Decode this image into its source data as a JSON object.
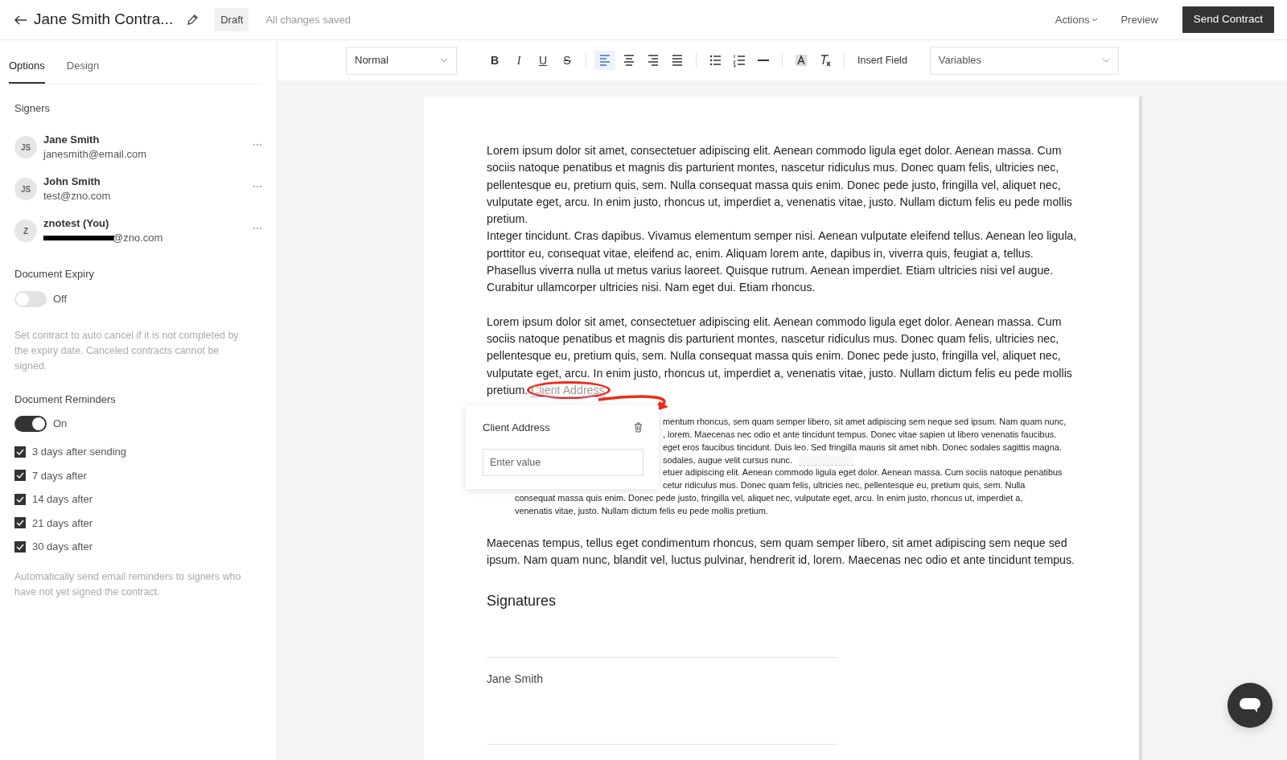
{
  "header": {
    "title": "Jane Smith Contra...",
    "status": "Draft",
    "save_state": "All changes saved",
    "actions": "Actions",
    "preview": "Preview",
    "primary": "Send Contract"
  },
  "sidebar": {
    "tabs": [
      {
        "label": "Options",
        "selected": true
      },
      {
        "label": "Design",
        "selected": false
      }
    ],
    "signers_heading": "Signers",
    "signers": [
      {
        "initials": "JS",
        "name": "Jane Smith",
        "email": "janesmith@email.com",
        "redacted": false
      },
      {
        "initials": "JS",
        "name": "John Smith",
        "email": "test@zno.com",
        "redacted": false
      },
      {
        "initials": "Z",
        "name": "znotest (You)",
        "email": "@zno.com",
        "redacted": true
      }
    ],
    "expiry": {
      "heading": "Document Expiry",
      "on": false,
      "state_label": "Off",
      "help": "Set contract to auto cancel if it is not completed by the expiry date. Canceled contracts cannot be signed."
    },
    "reminders": {
      "heading": "Document Reminders",
      "on": true,
      "state_label": "On",
      "items": [
        {
          "label": "3 days after sending",
          "checked": true
        },
        {
          "label": "7 days after",
          "checked": true
        },
        {
          "label": "14 days after",
          "checked": true
        },
        {
          "label": "21 days after",
          "checked": true
        },
        {
          "label": "30 days after",
          "checked": true
        }
      ],
      "help": "Automatically send email reminders to signers who have not yet signed the contract."
    }
  },
  "toolbar": {
    "style": "Normal",
    "tool_groups": [
      [
        {
          "kind": "bold",
          "label": "B",
          "selected": false
        },
        {
          "kind": "italic",
          "label": "I",
          "selected": false
        },
        {
          "kind": "underline",
          "label": "U",
          "selected": false
        },
        {
          "kind": "strike",
          "label": "S",
          "selected": false
        }
      ],
      [
        {
          "kind": "align-left",
          "selected": true
        },
        {
          "kind": "align-center",
          "selected": false
        },
        {
          "kind": "align-right",
          "selected": false
        },
        {
          "kind": "justify",
          "selected": false
        }
      ],
      [
        {
          "kind": "bullets",
          "selected": false
        },
        {
          "kind": "numbers",
          "selected": false
        },
        {
          "kind": "rule",
          "selected": false
        }
      ],
      [
        {
          "kind": "highlight",
          "selected": false
        },
        {
          "kind": "clear",
          "selected": false
        }
      ]
    ],
    "insert_field": "Insert Field",
    "variables": "Variables"
  },
  "document": {
    "blocks": [
      {
        "kind": "text",
        "paragraphs": [
          "Lorem ipsum dolor sit amet, consectetuer adipiscing elit. Aenean commodo ligula eget dolor. Aenean massa. Cum sociis natoque penatibus et magnis dis parturient montes, nascetur ridiculus mus. Donec quam felis, ultricies nec, pellentesque eu, pretium quis, sem. Nulla consequat massa quis enim. Donec pede justo, fringilla vel, aliquet nec, vulputate eget, arcu. In enim justo, rhoncus ut, imperdiet a, venenatis vitae, justo. Nullam dictum felis eu pede mollis pretium.",
          "Integer tincidunt. Cras dapibus. Vivamus elementum semper nisi. Aenean vulputate eleifend tellus. Aenean leo ligula, porttitor eu, consequat vitae, eleifend ac, enim. Aliquam lorem ante, dapibus in, viverra quis, feugiat a, tellus. Phasellus viverra nulla ut metus varius laoreet. Quisque rutrum. Aenean imperdiet. Etiam ultricies nisi vel augue. Curabitur ullamcorper ultricies nisi. Nam eget dui. Etiam rhoncus."
        ]
      },
      {
        "kind": "text",
        "paragraphs": [
          "Lorem ipsum dolor sit amet, consectetuer adipiscing elit. Aenean commodo ligula eget dolor. Aenean massa. Cum sociis natoque penatibus et magnis dis parturient montes, nascetur ridiculus mus. Donec quam felis, ultricies nec, pellentesque eu, pretium quis, sem. Nulla consequat massa quis enim. Donec pede justo, fringilla vel, aliquet nec, vulputate eget, arcu. In enim justo, rhoncus ut, imperdiet a, venenatis vitae, justo. Nullam dictum felis eu pede mollis pretium."
        ],
        "field": "Client Address"
      },
      {
        "kind": "quote",
        "popup": {
          "title": "Client Address",
          "placeholder": "Enter value"
        },
        "lines": [
          {
            "kind": "cut",
            "text": "mentum rhoncus, sem quam semper libero, sit amet adipiscing sem neque sed ipsum. Nam quam nunc,"
          },
          {
            "kind": "cut",
            "text": ", lorem. Maecenas nec odio et ante tincidunt tempus. Donec vitae sapien ut libero venenatis faucibus."
          },
          {
            "kind": "cut",
            "text": "eget eros faucibus tincidunt. Duis leo. Sed fringilla mauris sit amet nibh. Donec sodales sagittis magna."
          },
          {
            "kind": "cut",
            "text": "sodales, augue velit cursus nunc.",
            "blank_field": true
          },
          {
            "kind": "cut",
            "text": "etuer adipiscing elit. Aenean commodo ligula eget dolor. Aenean massa. Cum sociis natoque penatibus"
          },
          {
            "kind": "cut",
            "text": "cetur ridiculus mus. Donec quam felis, ultricies nec, pellentesque eu, pretium quis, sem. Nulla"
          },
          {
            "kind": "full",
            "text": "consequat massa quis enim. Donec pede justo, fringilla vel, aliquet nec, vulputate eget, arcu. In enim justo, rhoncus ut, imperdiet a,"
          },
          {
            "kind": "full",
            "text": "venenatis vitae, justo. Nullam dictum felis eu pede mollis pretium."
          }
        ]
      },
      {
        "kind": "text",
        "paragraphs": [
          "Maecenas tempus, tellus eget condimentum rhoncus, sem quam semper libero, sit amet adipiscing sem neque sed ipsum. Nam quam nunc, blandit vel, luctus pulvinar, hendrerit id, lorem. Maecenas nec odio et ante tincidunt tempus."
        ]
      },
      {
        "kind": "heading",
        "text": "Signatures"
      },
      {
        "kind": "signature",
        "name": "Jane Smith"
      }
    ]
  }
}
